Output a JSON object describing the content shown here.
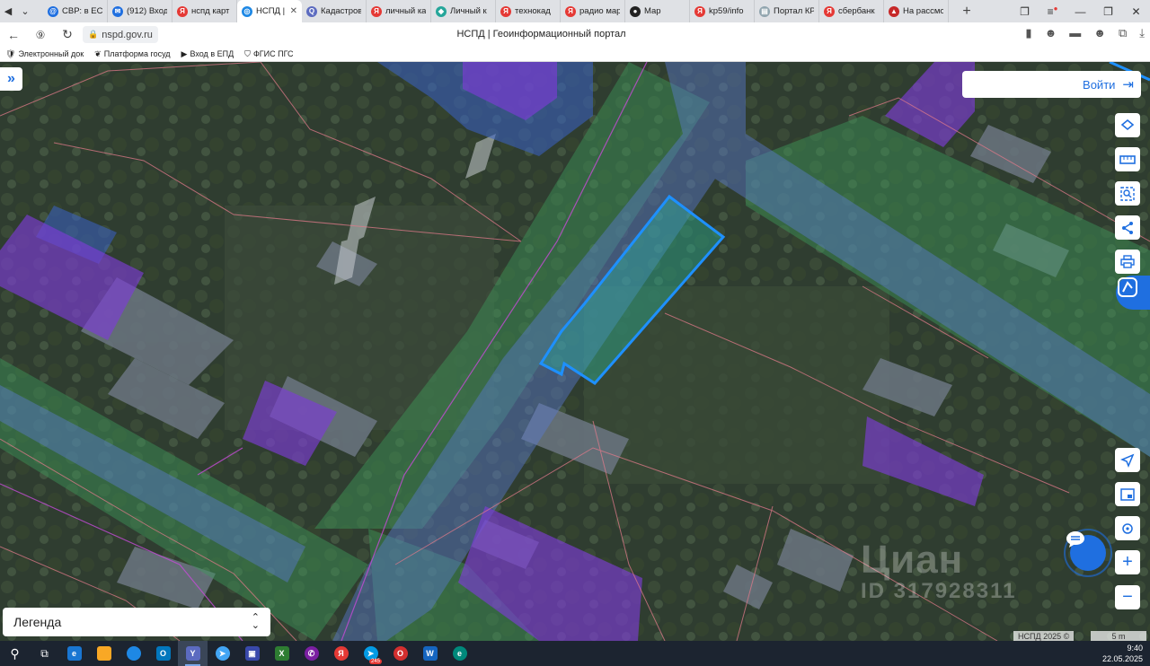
{
  "browser": {
    "tabs": [
      {
        "label": "СВР: в ЕС",
        "color": "#1f6fe0",
        "glyph": "@"
      },
      {
        "label": "(912) Вход",
        "color": "#1f6fe0",
        "glyph": "✉"
      },
      {
        "label": "нспд карт",
        "color": "#e53935",
        "glyph": "Я"
      },
      {
        "label": "НСПД |",
        "color": "#1e88e5",
        "glyph": "◎",
        "active": true
      },
      {
        "label": "Кадастров",
        "color": "#5c6bc0",
        "glyph": "Q"
      },
      {
        "label": "личный ка",
        "color": "#e53935",
        "glyph": "Я"
      },
      {
        "label": "Личный к",
        "color": "#26a69a",
        "glyph": "◆"
      },
      {
        "label": "технокад",
        "color": "#e53935",
        "glyph": "Я"
      },
      {
        "label": "радио мар",
        "color": "#e53935",
        "glyph": "Я"
      },
      {
        "label": "Мар",
        "color": "#222222",
        "glyph": "●"
      },
      {
        "label": "kp59/info",
        "color": "#e53935",
        "glyph": "Я"
      },
      {
        "label": "Портал КР",
        "color": "#90a4ae",
        "glyph": "▤"
      },
      {
        "label": "сбербанк",
        "color": "#e53935",
        "glyph": "Я"
      },
      {
        "label": "На рассмо",
        "color": "#c62828",
        "glyph": "▲"
      }
    ],
    "url": "nspd.gov.ru",
    "page_title": "НСПД | Геоинформационный портал",
    "bookmarks": [
      {
        "label": "Электронный док",
        "icon": "🛡"
      },
      {
        "label": "Платформа госуд",
        "icon": "❦"
      },
      {
        "label": "Вход в ЕПД",
        "icon": "▶"
      },
      {
        "label": "ФГИС ПГС",
        "icon": "⛉"
      }
    ]
  },
  "map": {
    "login_label": "Войти",
    "legend_label": "Легенда",
    "copyright": "НСПД 2025 ©",
    "scale_label": "5 m",
    "watermark_brand": "Циан",
    "watermark_id": "ID 317928311",
    "highlight_color": "#1e90ff"
  },
  "taskbar": {
    "time": "9:40",
    "date": "22.05.2025",
    "badge": "245"
  }
}
